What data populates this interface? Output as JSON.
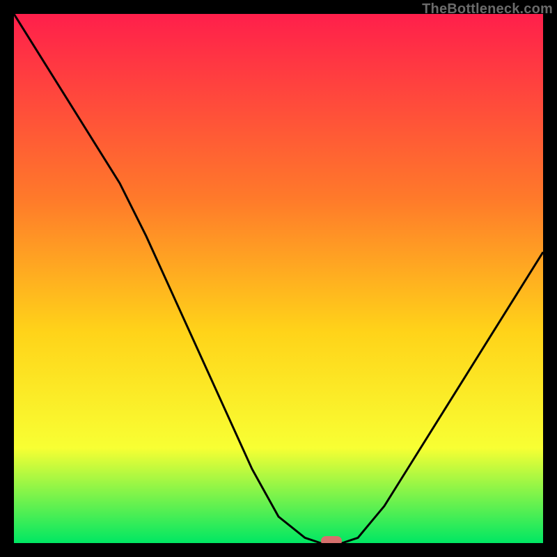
{
  "watermark": "TheBottleneck.com",
  "chart_data": {
    "type": "line",
    "title": "",
    "xlabel": "",
    "ylabel": "",
    "x": [
      0,
      5,
      10,
      15,
      20,
      25,
      30,
      35,
      40,
      45,
      50,
      55,
      58,
      62,
      65,
      70,
      75,
      80,
      85,
      90,
      95,
      100
    ],
    "values": [
      100,
      92,
      84,
      76,
      68,
      58,
      47,
      36,
      25,
      14,
      5,
      1,
      0,
      0,
      1,
      7,
      15,
      23,
      31,
      39,
      47,
      55
    ],
    "xlim": [
      0,
      100
    ],
    "ylim": [
      0,
      100
    ],
    "optimal_marker": {
      "x": 60,
      "y": 0
    },
    "background_gradient": {
      "top": "#ff1f4b",
      "mid_upper": "#ff7a2a",
      "mid": "#ffd319",
      "mid_lower": "#f8ff33",
      "bottom": "#00e763"
    },
    "annotations": []
  }
}
